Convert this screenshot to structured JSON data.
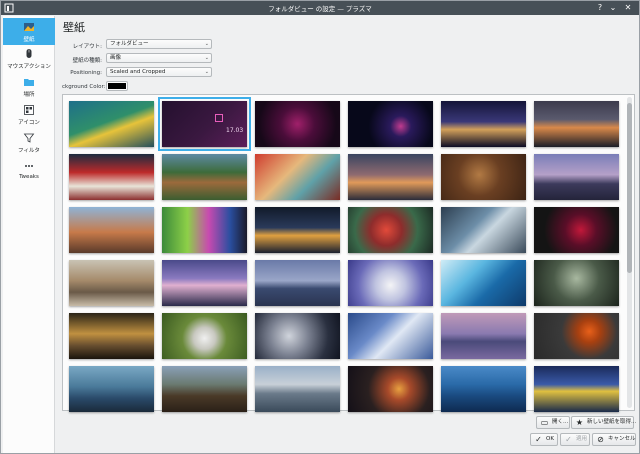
{
  "window": {
    "title": "フォルダビュー の設定 — プラズマ"
  },
  "sidebar": {
    "items": [
      {
        "label": "壁紙",
        "icon": "wallpaper-icon",
        "selected": true
      },
      {
        "label": "マウスアクション",
        "icon": "mouse-icon",
        "selected": false
      },
      {
        "label": "場所",
        "icon": "folder-icon",
        "selected": false
      },
      {
        "label": "アイコン",
        "icon": "icons-icon",
        "selected": false
      },
      {
        "label": "フィルタ",
        "icon": "filter-icon",
        "selected": false
      },
      {
        "label": "Tweaks",
        "icon": "tweaks-icon",
        "selected": false
      }
    ]
  },
  "main": {
    "title": "壁紙",
    "form": {
      "layout_label": "レイアウト:",
      "layout_value": "フォルダビュー",
      "type_label": "壁紙の種類:",
      "type_value": "画像",
      "positioning_label": "Positioning:",
      "positioning_value": "Scaled and Cropped",
      "bg_color_label": "ckground Color:",
      "bg_color_value": "#000000"
    },
    "thumbnail_overlay_text": "17.03"
  },
  "buttons": {
    "open": "開く...",
    "new_wallpaper": "新しい壁紙を取得...",
    "ok": "OK",
    "apply": "適用",
    "cancel": "キャンセル"
  },
  "colors": {
    "accent": "#3daee9",
    "titlebar": "#475057"
  }
}
